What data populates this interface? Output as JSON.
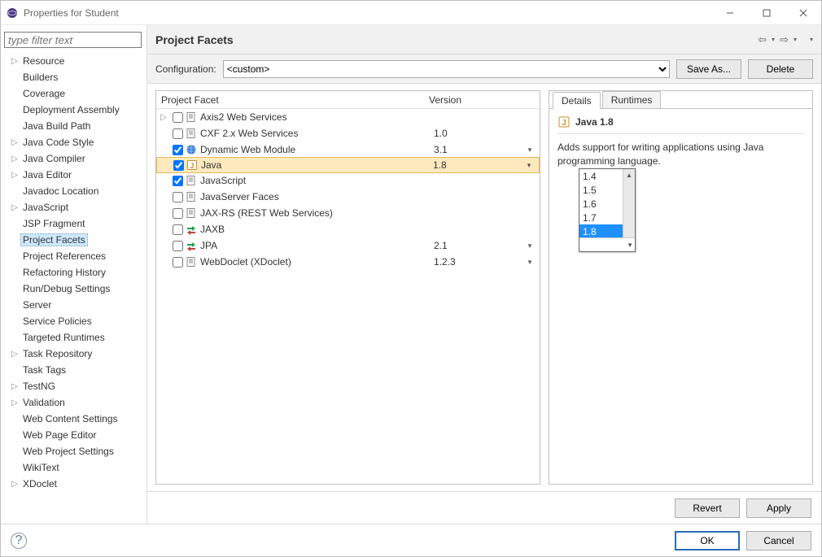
{
  "window": {
    "title": "Properties for Student"
  },
  "sidebar": {
    "filter_placeholder": "type filter text",
    "items": [
      {
        "label": "Resource",
        "expandable": true
      },
      {
        "label": "Builders"
      },
      {
        "label": "Coverage"
      },
      {
        "label": "Deployment Assembly"
      },
      {
        "label": "Java Build Path"
      },
      {
        "label": "Java Code Style",
        "expandable": true
      },
      {
        "label": "Java Compiler",
        "expandable": true
      },
      {
        "label": "Java Editor",
        "expandable": true
      },
      {
        "label": "Javadoc Location"
      },
      {
        "label": "JavaScript",
        "expandable": true
      },
      {
        "label": "JSP Fragment"
      },
      {
        "label": "Project Facets",
        "selected": true
      },
      {
        "label": "Project References"
      },
      {
        "label": "Refactoring History"
      },
      {
        "label": "Run/Debug Settings"
      },
      {
        "label": "Server"
      },
      {
        "label": "Service Policies"
      },
      {
        "label": "Targeted Runtimes"
      },
      {
        "label": "Task Repository",
        "expandable": true
      },
      {
        "label": "Task Tags"
      },
      {
        "label": "TestNG",
        "expandable": true
      },
      {
        "label": "Validation",
        "expandable": true
      },
      {
        "label": "Web Content Settings"
      },
      {
        "label": "Web Page Editor"
      },
      {
        "label": "Web Project Settings"
      },
      {
        "label": "WikiText"
      },
      {
        "label": "XDoclet",
        "expandable": true
      }
    ]
  },
  "page": {
    "title": "Project Facets",
    "config_label": "Configuration:",
    "config_value": "<custom>",
    "save_as": "Save As...",
    "delete": "Delete",
    "col_facet": "Project Facet",
    "col_version": "Version",
    "facets": [
      {
        "name": "Axis2 Web Services",
        "checked": false,
        "version": "",
        "dd": false,
        "icon": "doc",
        "exp": true
      },
      {
        "name": "CXF 2.x Web Services",
        "checked": false,
        "version": "1.0",
        "dd": false,
        "icon": "doc"
      },
      {
        "name": "Dynamic Web Module",
        "checked": true,
        "version": "3.1",
        "dd": true,
        "icon": "globe"
      },
      {
        "name": "Java",
        "checked": true,
        "version": "1.8",
        "dd": true,
        "icon": "j",
        "selected": true
      },
      {
        "name": "JavaScript",
        "checked": true,
        "version": "",
        "dd": false,
        "icon": "doc"
      },
      {
        "name": "JavaServer Faces",
        "checked": false,
        "version": "",
        "dd": false,
        "icon": "doc"
      },
      {
        "name": "JAX-RS (REST Web Services)",
        "checked": false,
        "version": "",
        "dd": false,
        "icon": "doc"
      },
      {
        "name": "JAXB",
        "checked": false,
        "version": "",
        "dd": false,
        "icon": "arrows"
      },
      {
        "name": "JPA",
        "checked": false,
        "version": "2.1",
        "dd": true,
        "icon": "arrows"
      },
      {
        "name": "WebDoclet (XDoclet)",
        "checked": false,
        "version": "1.2.3",
        "dd": true,
        "icon": "doc"
      }
    ],
    "version_dropdown": {
      "options": [
        "1.4",
        "1.5",
        "1.6",
        "1.7",
        "1.8"
      ],
      "selected": "1.8"
    },
    "tabs": {
      "details": "Details",
      "runtimes": "Runtimes"
    },
    "details": {
      "title": "Java 1.8",
      "description": "Adds support for writing applications using Java programming language."
    },
    "revert": "Revert",
    "apply": "Apply"
  },
  "dialog": {
    "ok": "OK",
    "cancel": "Cancel"
  }
}
